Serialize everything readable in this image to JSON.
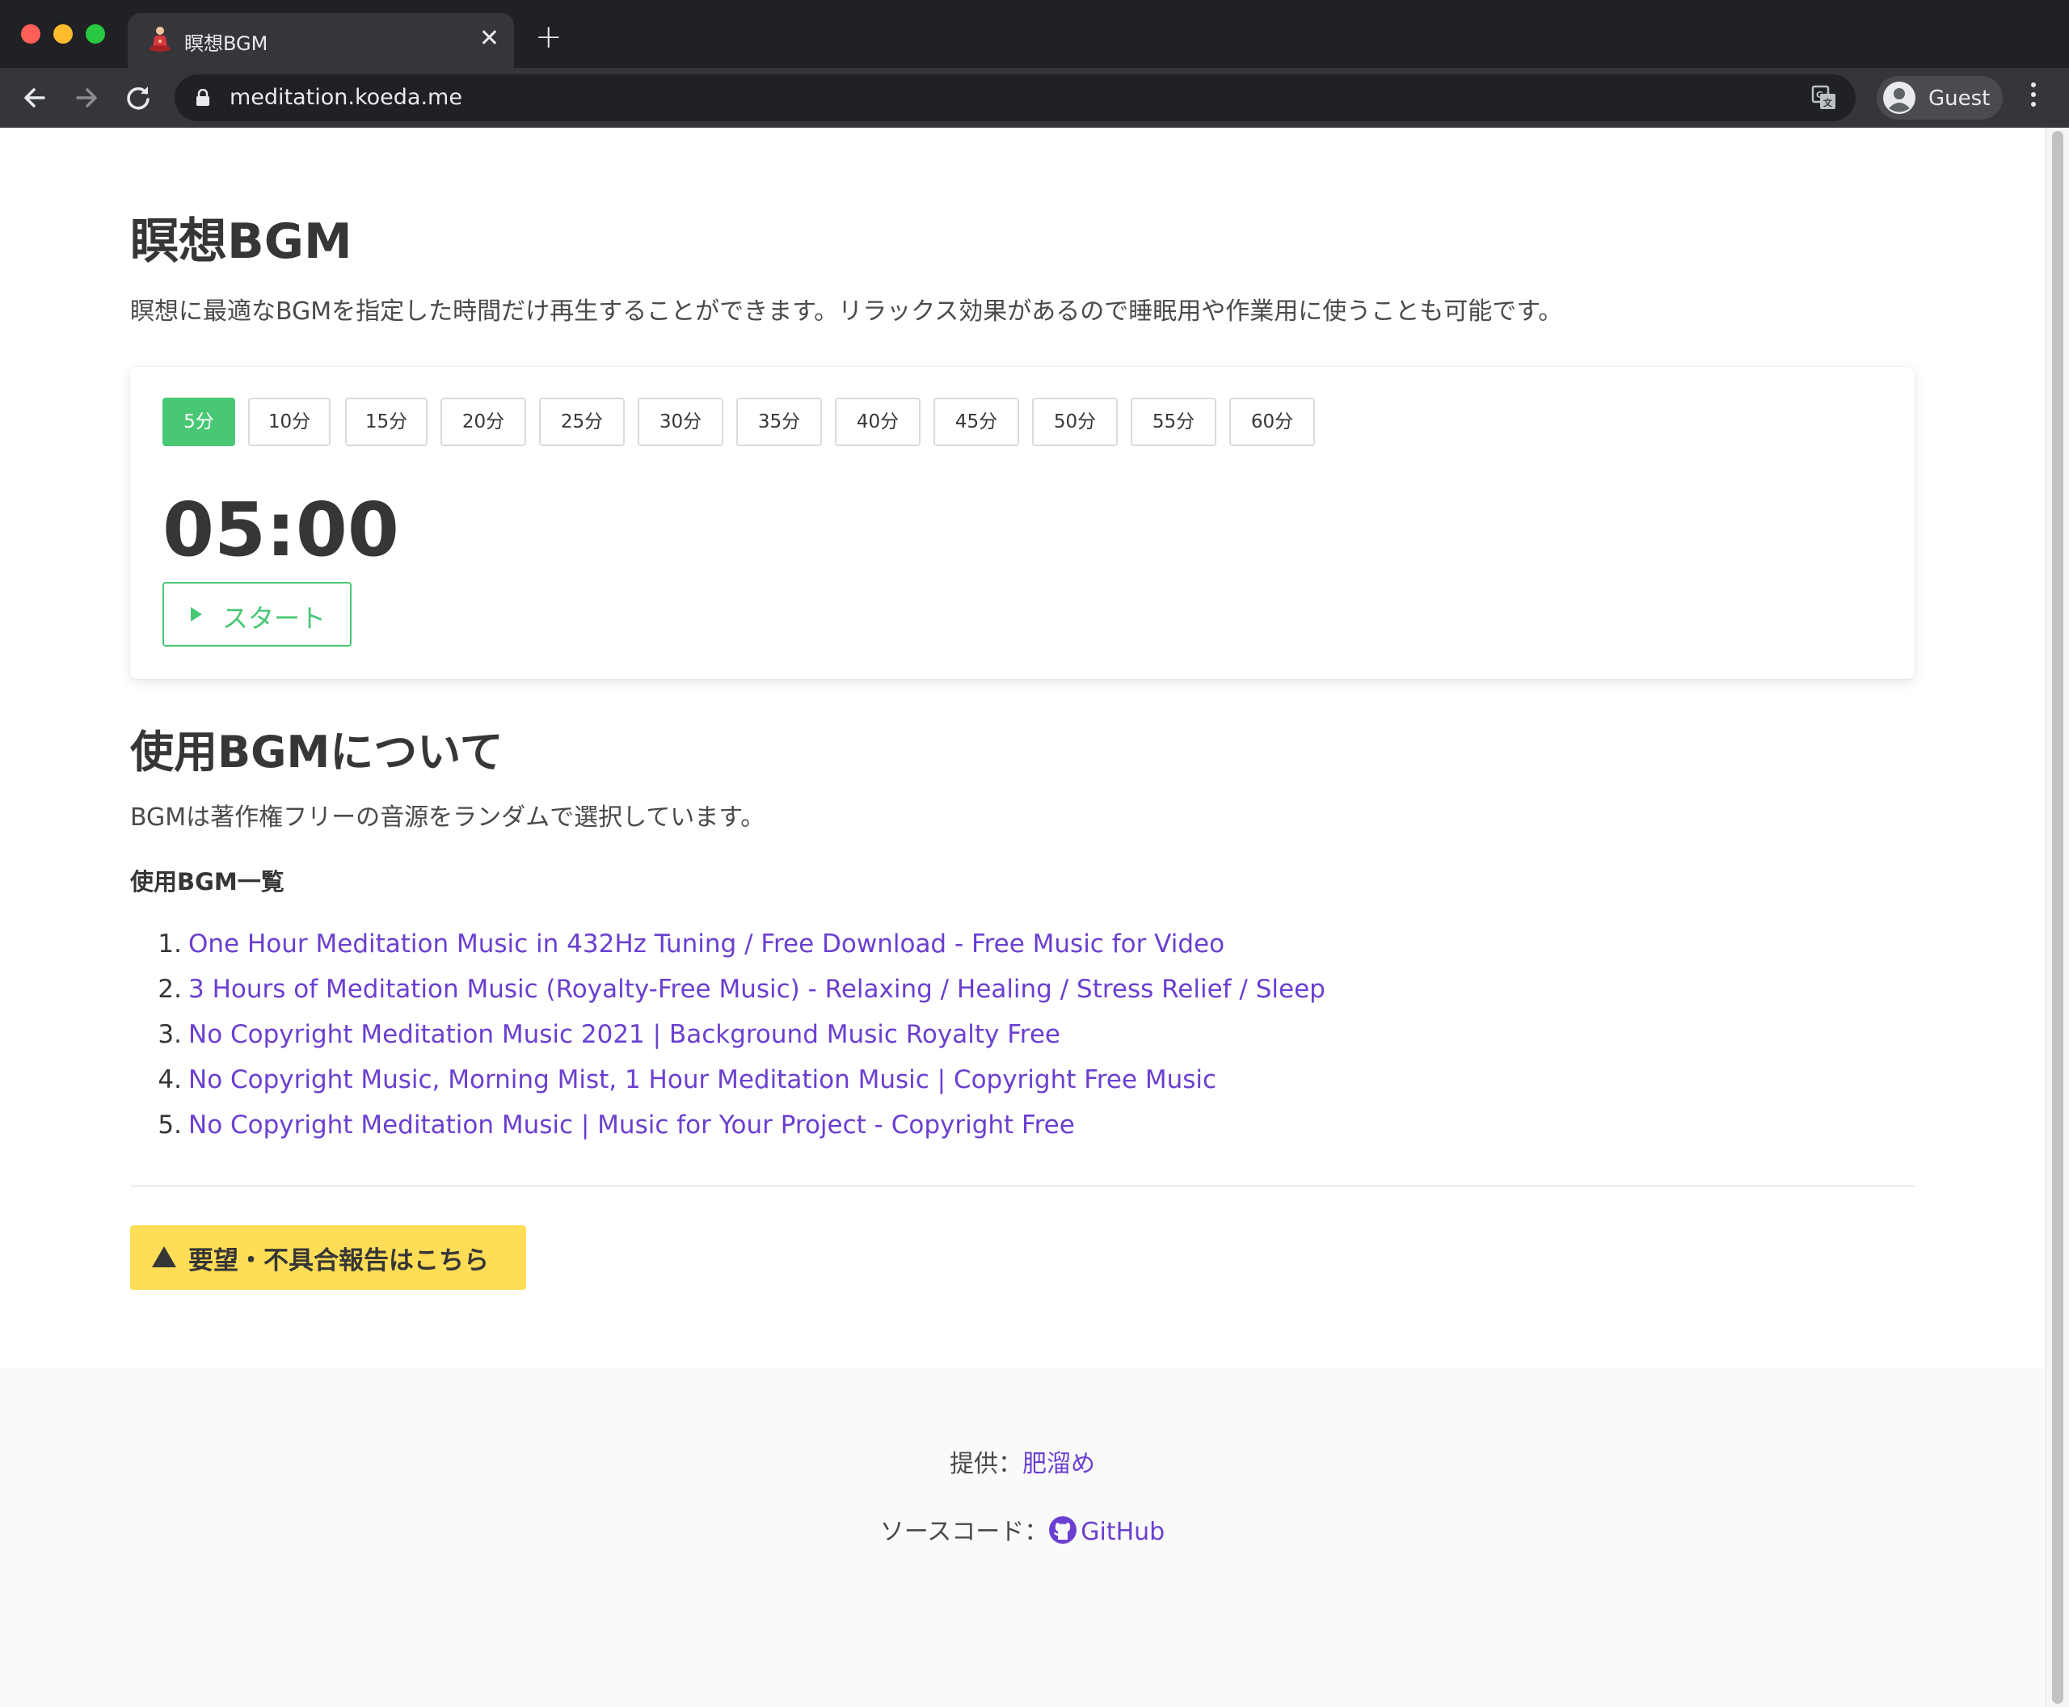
{
  "browser": {
    "tab_title": "瞑想BGM",
    "url": "meditation.koeda.me",
    "profile_name": "Guest",
    "new_tab_symbol": "+",
    "close_tab_symbol": "✕"
  },
  "page": {
    "title": "瞑想BGM",
    "description": "瞑想に最適なBGMを指定した時間だけ再生することができます。リラックス効果があるので睡眠用や作業用に使うことも可能です。"
  },
  "timer": {
    "durations": [
      "5分",
      "10分",
      "15分",
      "20分",
      "25分",
      "30分",
      "35分",
      "40分",
      "45分",
      "50分",
      "55分",
      "60分"
    ],
    "selected": "5分",
    "display": "05:00",
    "start_label": "スタート"
  },
  "about": {
    "title": "使用BGMについて",
    "description": "BGMは著作権フリーの音源をランダムで選択しています。",
    "list_heading": "使用BGM一覧",
    "items": [
      {
        "num": "1.",
        "title": "One Hour Meditation Music in 432Hz Tuning / Free Download - Free Music for Video"
      },
      {
        "num": "2.",
        "title": "3 Hours of Meditation Music (Royalty-Free Music) - Relaxing / Healing / Stress Relief / Sleep"
      },
      {
        "num": "3.",
        "title": "No Copyright Meditation Music 2021 | Background Music Royalty Free"
      },
      {
        "num": "4.",
        "title": "No Copyright Music, Morning Mist, 1 Hour Meditation Music | Copyright Free Music"
      },
      {
        "num": "5.",
        "title": "No Copyright Meditation Music | Music for Your Project - Copyright Free"
      }
    ]
  },
  "report_button": "要望・不具合報告はこちら",
  "footer": {
    "provider_label": "提供：",
    "provider_name": "肥溜め",
    "source_label": "ソースコード：",
    "source_link": "GitHub"
  },
  "colors": {
    "primary_green": "#48c774",
    "warning_yellow": "#ffdd57",
    "link_purple": "#6b3fd0"
  }
}
